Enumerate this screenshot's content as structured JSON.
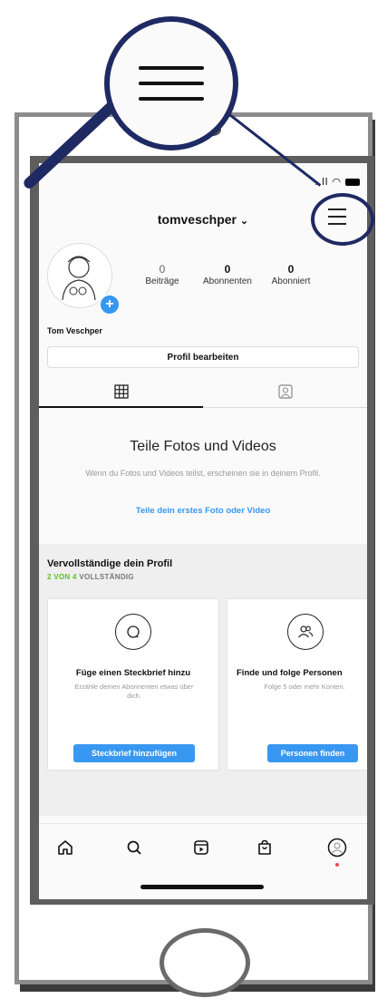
{
  "status_bar": {
    "signal": "..ll"
  },
  "header": {
    "username": "tomveschper",
    "chevron": "chevron-down-icon",
    "menu_icon": "hamburger-menu-icon"
  },
  "profile": {
    "full_name": "Tom Veschper",
    "stats": [
      {
        "value": "0",
        "label": "Beiträge"
      },
      {
        "value": "0",
        "label": "Abonnenten"
      },
      {
        "value": "0",
        "label": "Abonniert"
      }
    ],
    "edit_button": "Profil bearbeiten"
  },
  "tabs": [
    {
      "icon": "grid-icon",
      "active": true
    },
    {
      "icon": "tagged-person-icon",
      "active": false
    }
  ],
  "empty_state": {
    "title": "Teile Fotos und Videos",
    "text": "Wenn du Fotos und Videos teilst, erscheinen sie in deinem Profil.",
    "link": "Teile dein erstes Foto oder Video"
  },
  "complete_profile": {
    "title": "Vervollständige dein Profil",
    "progress_count": "2 VON 4",
    "progress_label": "VOLLSTÄNDIG",
    "progress_fraction": 0.5,
    "cards": [
      {
        "icon": "speech-bubble-icon",
        "title": "Füge einen Steckbrief hinzu",
        "text": "Erzähle deinen Abonnenten etwas über dich.",
        "button": "Steckbrief hinzufügen"
      },
      {
        "icon": "people-icon",
        "title": "Finde und folge Personen",
        "text": "Folge 5 oder mehr Konten.",
        "button": "Personen finden"
      }
    ]
  },
  "bottom_nav": [
    "home-icon",
    "search-icon",
    "reels-icon",
    "shop-icon",
    "profile-avatar-icon"
  ],
  "colors": {
    "accent": "#3897f0",
    "progress_green": "#58c322",
    "callout": "#1f2a63",
    "notification": "#ed4956"
  }
}
